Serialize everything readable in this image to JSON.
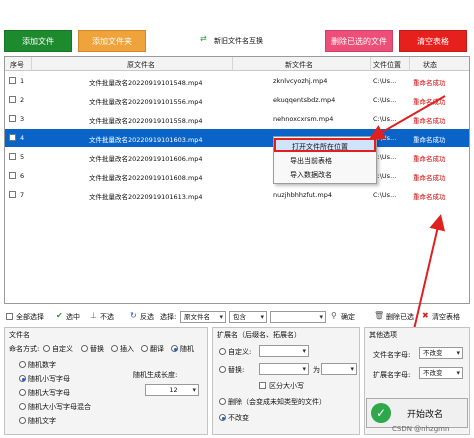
{
  "top_buttons": {
    "add_files": "添加文件",
    "add_folder": "添加文件夹",
    "swap_names": "新旧文件名互换",
    "delete_selected": "删除已选的文件",
    "clear_table": "清空表格"
  },
  "colors": {
    "green_btn": "#1e8a2e",
    "orange_btn": "#f0a33a",
    "pink_btn": "#ee4f78",
    "red_btn": "#e6201c",
    "selected_row": "#0a64c8",
    "status_red": "#d40000"
  },
  "table": {
    "headers": [
      "序号",
      "原文件名",
      "新文件名",
      "文件位置",
      "状态"
    ],
    "rows": [
      {
        "no": "1",
        "old": "文件批量改名20220919101548.mp4",
        "new": "zknlvcyozhj.mp4",
        "loc": "C:\\Us...",
        "status": "重命名成功"
      },
      {
        "no": "2",
        "old": "文件批量改名20220919101556.mp4",
        "new": "ekuqqentsbdz.mp4",
        "loc": "C:\\Us...",
        "status": "重命名成功"
      },
      {
        "no": "3",
        "old": "文件批量改名20220919101558.mp4",
        "new": "nehnoxcxrsm.mp4",
        "loc": "C:\\Us...",
        "status": "重命名成功"
      },
      {
        "no": "4",
        "old": "文件批量改名20220919101603.mp4",
        "new": "",
        "loc": "C:\\Us...",
        "status": "重命名成功"
      },
      {
        "no": "5",
        "old": "文件批量改名20220919101606.mp4",
        "new": "",
        "loc": "C:\\Us...",
        "status": "重命名成功"
      },
      {
        "no": "6",
        "old": "文件批量改名20220919101608.mp4",
        "new": "",
        "loc": "C:\\Us...",
        "status": "重命名成功"
      },
      {
        "no": "7",
        "old": "文件批量改名20220919101613.mp4",
        "new": "nuzjhbhhzfut.mp4",
        "loc": "C:\\Us...",
        "status": "重命名成功"
      }
    ]
  },
  "context_menu": {
    "open_location": "打开文件所在位置",
    "export_table": "导出当前表格",
    "import_data": "导入数据改名"
  },
  "select_toolbar": {
    "select_all": "全部选择",
    "select_mid": "选中",
    "unselect": "不选",
    "invert": "反选",
    "select_label": "选择:",
    "field_value": "原文件名",
    "mode_value": "包含",
    "confirm": "确定",
    "delete_checked": "删除已选",
    "clear_table": "清空表格"
  },
  "filename_panel": {
    "title": "文件名",
    "mode_label": "命名方式:",
    "modes": [
      "自定义",
      "替换",
      "插入",
      "翻译",
      "随机"
    ],
    "mode_selected_index": 4,
    "random_options": [
      "随机数字",
      "随机小写字母",
      "随机大写字母",
      "随机大小写字母混合",
      "随机文字"
    ],
    "random_selected_index": 1,
    "length_label": "随机生成长度:",
    "length_value": "12"
  },
  "ext_panel": {
    "title": "扩展名（后缀名、拓展名）",
    "custom": "自定义:",
    "replace": "替换:",
    "as_label": "为",
    "case_sensitive": "区分大小写",
    "delete": "删除（会变成未知类型的文件）",
    "no_change": "不改变",
    "selected": "no_change"
  },
  "other_panel": {
    "title": "其他选项",
    "name_case_label": "文件名字母:",
    "name_case_value": "不改变",
    "ext_case_label": "扩展名字母:",
    "ext_case_value": "不改变"
  },
  "start_button": "开始改名",
  "watermark": "CSDN @nhzgmn"
}
